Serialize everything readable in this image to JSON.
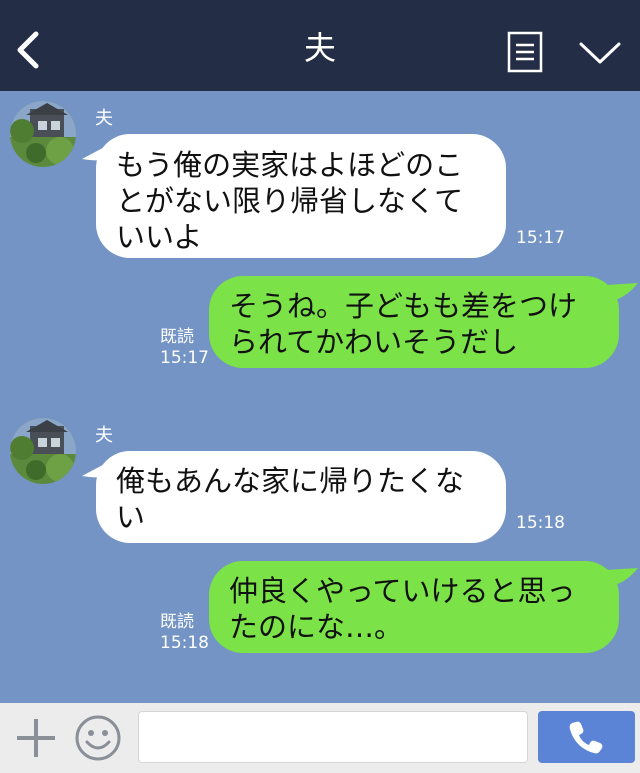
{
  "header": {
    "title": "夫",
    "back_icon": "chevron-left-icon",
    "menu_icon": "list-icon",
    "collapse_icon": "chevron-down-icon"
  },
  "messages": [
    {
      "direction": "incoming",
      "sender": "夫",
      "lines": [
        "もう俺の実家はよほどのこ",
        "とがない限り帰省しなくて",
        "いいよ"
      ],
      "time": "15:17"
    },
    {
      "direction": "outgoing",
      "lines": [
        "そうね。子どもも差をつけ",
        "られてかわいそうだし"
      ],
      "read_label": "既読",
      "time": "15:17"
    },
    {
      "direction": "incoming",
      "sender": "夫",
      "lines": [
        "俺もあんな家に帰りたくな",
        "い"
      ],
      "time": "15:18"
    },
    {
      "direction": "outgoing",
      "lines": [
        "仲良くやっていけると思っ",
        "たのにな…。"
      ],
      "read_label": "既読",
      "time": "15:18"
    }
  ],
  "input_bar": {
    "placeholder": "",
    "plus_icon": "plus-icon",
    "emoji_icon": "smile-icon",
    "call_icon": "phone-icon"
  },
  "colors": {
    "header_bg": "#232d46",
    "chat_bg": "#7394c4",
    "incoming_bubble": "#ffffff",
    "outgoing_bubble": "#7be247",
    "call_button": "#5c84d6"
  }
}
